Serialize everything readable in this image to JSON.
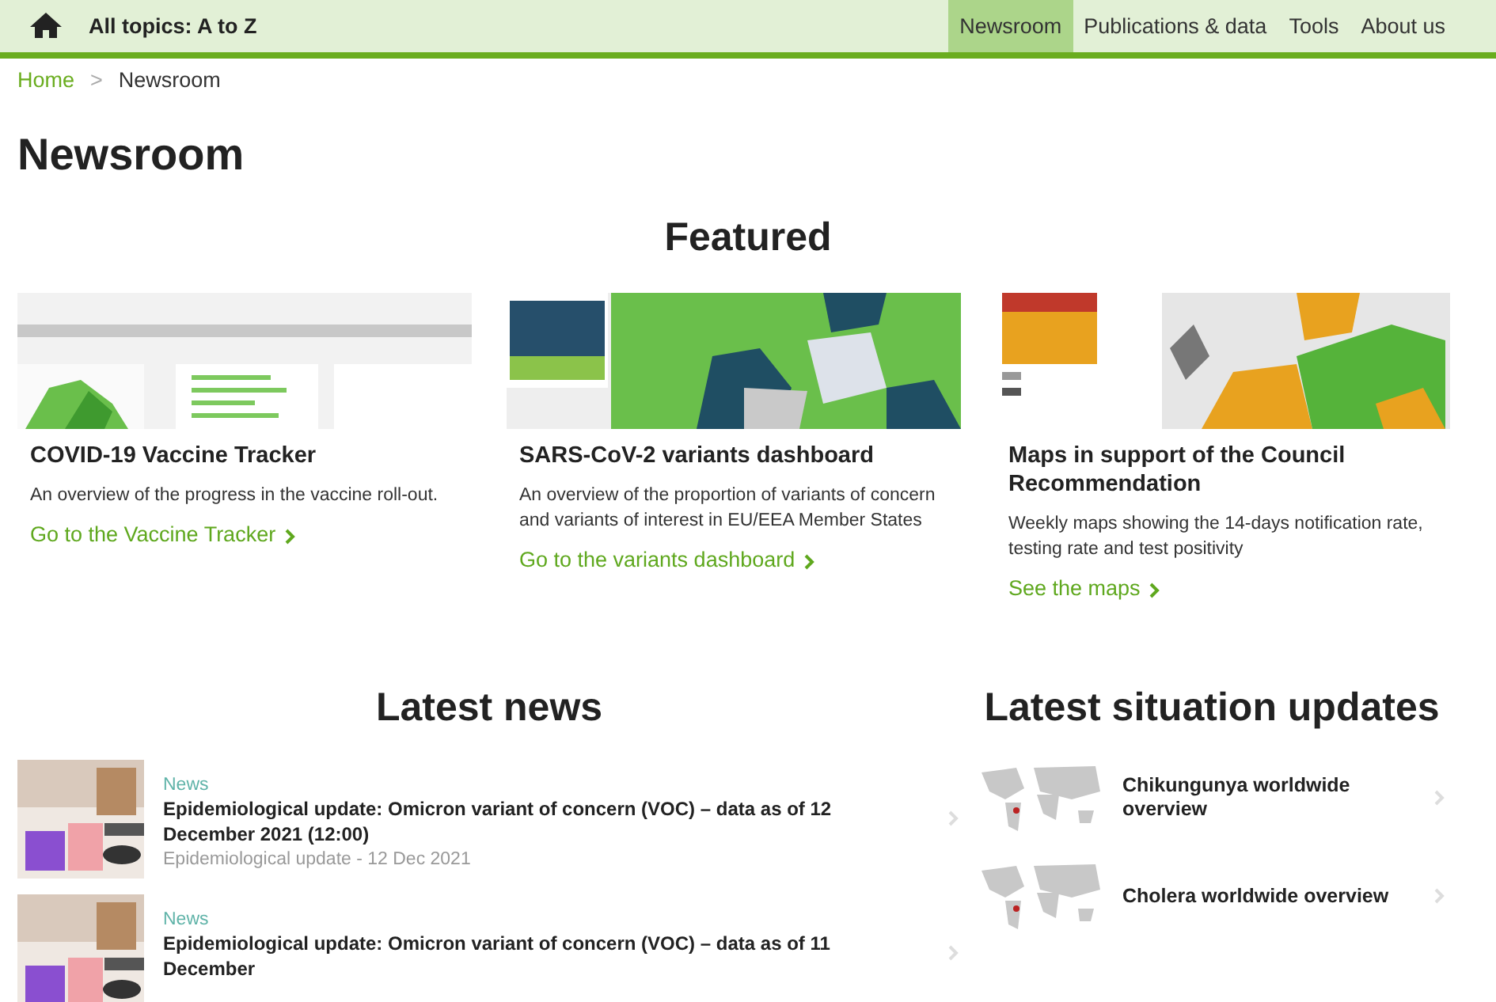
{
  "nav": {
    "topics": "All topics: A to Z",
    "items": [
      {
        "label": "Newsroom",
        "selected": true
      },
      {
        "label": "Publications & data",
        "selected": false
      },
      {
        "label": "Tools",
        "selected": false
      },
      {
        "label": "About us",
        "selected": false
      }
    ]
  },
  "breadcrumb": {
    "separator": ">",
    "items": [
      {
        "label": "Home",
        "kind": "link"
      },
      {
        "label": "Newsroom",
        "kind": "current"
      }
    ]
  },
  "page_title": "Newsroom",
  "featured": {
    "heading": "Featured",
    "cards": [
      {
        "title": "COVID-19 Vaccine Tracker",
        "description": "An overview of the progress in the vaccine roll-out.",
        "link": "Go to the Vaccine Tracker"
      },
      {
        "title": "SARS-CoV-2 variants dashboard",
        "description": "An overview of the proportion of variants of concern and variants of interest in EU/EEA Member States",
        "link": "Go to the variants dashboard"
      },
      {
        "title": "Maps in support of the Council Recommendation",
        "description": "Weekly maps showing the 14-days notification rate, testing rate and test positivity",
        "link": "See the maps"
      }
    ]
  },
  "latest_news": {
    "heading": "Latest news",
    "items": [
      {
        "category": "News",
        "title": "Epidemiological update: Omicron variant of concern (VOC) – data as of 12 December 2021 (12:00)",
        "meta": "Epidemiological update - 12 Dec 2021"
      },
      {
        "category": "News",
        "title": "Epidemiological update: Omicron variant of concern (VOC) – data as of 11 December"
      }
    ]
  },
  "situation_updates": {
    "heading": "Latest situation updates",
    "items": [
      {
        "title": "Chikungunya worldwide overview"
      },
      {
        "title": "Cholera worldwide overview"
      }
    ]
  }
}
